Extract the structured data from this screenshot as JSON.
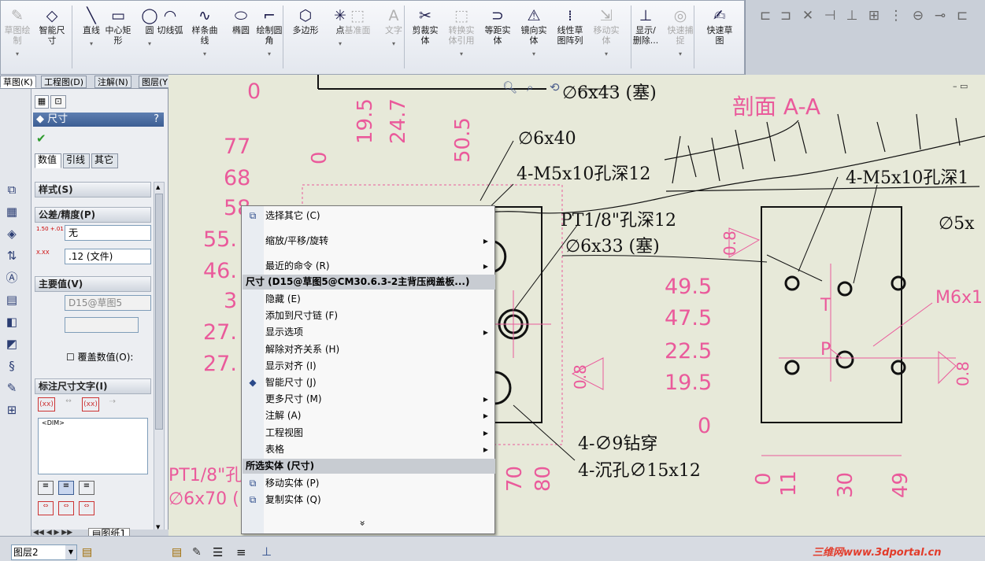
{
  "ribbon": {
    "tools": [
      {
        "label": "草图绘\n制",
        "icon": "sketch-icon",
        "enabled": false
      },
      {
        "label": "智能尺\n寸",
        "icon": "smart-dimension-icon",
        "enabled": true
      },
      {
        "label": "直线",
        "icon": "line-icon",
        "enabled": true
      },
      {
        "label": "中心矩\n形",
        "icon": "center-rectangle-icon",
        "enabled": true
      },
      {
        "label": "圆",
        "icon": "circle-icon",
        "enabled": true
      },
      {
        "label": "切线弧",
        "icon": "tangent-arc-icon",
        "enabled": true
      },
      {
        "label": "样条曲\n线",
        "icon": "spline-icon",
        "enabled": true
      },
      {
        "label": "椭圆",
        "icon": "ellipse-icon",
        "enabled": true
      },
      {
        "label": "绘制圆\n角",
        "icon": "sketch-fillet-icon",
        "enabled": true
      },
      {
        "label": "多边形",
        "icon": "polygon-icon",
        "enabled": true
      },
      {
        "label": "点",
        "icon": "point-icon",
        "enabled": true
      },
      {
        "label": "基准面",
        "icon": "plane-icon",
        "enabled": false
      },
      {
        "label": "文字",
        "icon": "text-icon",
        "enabled": false
      },
      {
        "label": "剪裁实\n体",
        "icon": "trim-icon",
        "enabled": true
      },
      {
        "label": "转换实\n体引用",
        "icon": "convert-entities-icon",
        "enabled": false
      },
      {
        "label": "等距实\n体",
        "icon": "offset-entities-icon",
        "enabled": true
      },
      {
        "label": "镜向实\n体",
        "icon": "mirror-icon",
        "enabled": true
      },
      {
        "label": "线性草\n图阵列",
        "icon": "linear-pattern-icon",
        "enabled": true
      },
      {
        "label": "移动实\n体",
        "icon": "move-entities-icon",
        "enabled": false
      },
      {
        "label": "显示/\n删除...",
        "icon": "display-delete-relations-icon",
        "enabled": true
      },
      {
        "label": "快速捕\n捉",
        "icon": "quick-snap-icon",
        "enabled": false
      },
      {
        "label": "快速草\n图",
        "icon": "rapid-sketch-icon",
        "enabled": true
      }
    ]
  },
  "tabs": [
    "草图(K)",
    "工程图(D)",
    "注解(N)",
    "图层(Y)"
  ],
  "panel": {
    "title": "尺寸",
    "help": "?",
    "subtabs": [
      "数值",
      "引线",
      "其它"
    ],
    "groups": {
      "style": "样式(S)",
      "tolerance": "公差/精度(P)",
      "primary": "主要值(V)",
      "dimtext": "标注尺寸文字(I)"
    },
    "tolerance_value": "无",
    "precision_value": ".12 (文件)",
    "primary_value": "D15@草图5",
    "override_label": "覆盖数值(O):",
    "dim_text": "<DIM>",
    "tol_icon_text": "1.50 +.01 -.01",
    "prec_icon_text": "X.XX"
  },
  "context_menu": {
    "top_items": [
      {
        "label": "选择其它 (C)",
        "has_sub": false,
        "icon": "select-other-icon"
      },
      {
        "label": "缩放/平移/旋转",
        "has_sub": true
      },
      {
        "label": "最近的命令 (R)",
        "has_sub": true
      }
    ],
    "header1": "尺寸 (D15@草图5@CM30.6.3-2主背压阀盖板...)",
    "mid_items": [
      {
        "label": "隐藏 (E)",
        "has_sub": false
      },
      {
        "label": "添加到尺寸链 (F)",
        "has_sub": false
      },
      {
        "label": "显示选项",
        "has_sub": true
      },
      {
        "label": "解除对齐关系 (H)",
        "has_sub": false
      },
      {
        "label": "显示对齐 (I)",
        "has_sub": false
      },
      {
        "label": "智能尺寸 (J)",
        "has_sub": false,
        "icon": "smart-dimension-icon"
      },
      {
        "label": "更多尺寸 (M)",
        "has_sub": true
      },
      {
        "label": "注解 (A)",
        "has_sub": true
      },
      {
        "label": "工程视图",
        "has_sub": true
      },
      {
        "label": "表格",
        "has_sub": true
      }
    ],
    "header2": "所选实体 (尺寸)",
    "bottom_items": [
      {
        "label": "移动实体 (P)",
        "icon": "move-entity-icon"
      },
      {
        "label": "复制实体 (Q)",
        "icon": "copy-entity-icon"
      }
    ],
    "more": "»"
  },
  "drawing": {
    "section_title": "剖面 A-A",
    "callouts": {
      "c1": "∅6x43 (塞)",
      "c2": "∅6x40",
      "c3": "4-M5x10孔深12",
      "c4": "4-M5x10孔深1",
      "c5": "PT1/8\"孔深12",
      "c6": "∅6x33 (塞)",
      "c7": "∅5x",
      "c8": "4-∅9钻穿",
      "c9": "4-沉孔∅15x12",
      "c10": "PT1/8\"孔",
      "c11": "∅6x70 (",
      "c12": "M6x1"
    },
    "left_dims": [
      "0",
      "77",
      "68",
      "58",
      "55.",
      "46.",
      "3",
      "27.",
      "27."
    ],
    "left_top_dims": [
      "0",
      "19.5",
      "24.7",
      "50.5"
    ],
    "left_bottom_dims": [
      "70",
      "80"
    ],
    "right_dims": [
      "49.5",
      "47.5",
      "22.5",
      "19.5",
      "0"
    ],
    "bottom_dims": [
      "0",
      "11",
      "30",
      "49"
    ],
    "ribs": [
      "0.8",
      "0.8",
      "0.8"
    ],
    "labels": {
      "t": "T",
      "p": "P"
    }
  },
  "sheet_tab": "图纸1",
  "status": {
    "layer": "图层2"
  },
  "watermark": "三维网www.3dportal.cn",
  "colors": {
    "accent": "#3c5d93",
    "dim": "#ea5a9b",
    "background": "#e7e9d9"
  }
}
